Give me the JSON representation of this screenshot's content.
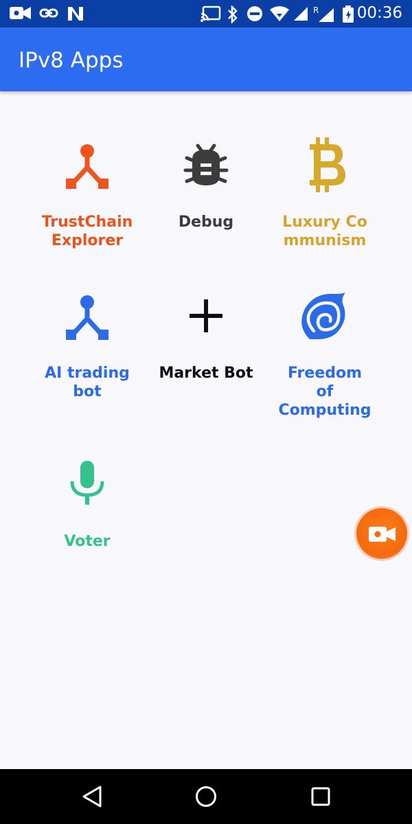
{
  "status_bar": {
    "time": "00:36",
    "icons": [
      "video-camera-icon",
      "link-icon",
      "n-logo-icon",
      "cast-icon",
      "bluetooth-icon",
      "do-not-disturb-icon",
      "wifi-icon",
      "signal-icon",
      "roaming-signal-icon",
      "battery-icon"
    ]
  },
  "app_bar": {
    "title": "IPv8 Apps"
  },
  "apps": [
    {
      "label": "TrustChain\nExplorer",
      "icon": "trustchain-icon",
      "color": "#e8541a"
    },
    {
      "label": "Debug",
      "icon": "bug-icon",
      "color": "#3c3c3c"
    },
    {
      "label": "Luxury Co\nmmunism",
      "icon": "bitcoin-icon",
      "color": "#d4a52a"
    },
    {
      "label": "AI trading\nbot",
      "icon": "network-icon",
      "color": "#2b6be8"
    },
    {
      "label": "Market Bot",
      "icon": "plus-icon",
      "color": "#0f0f0f"
    },
    {
      "label": "Freedom\nof\nComputing",
      "icon": "swirl-icon",
      "color": "#2b6be8"
    },
    {
      "label": "Voter",
      "icon": "microphone-icon",
      "color": "#34c28a"
    }
  ],
  "fab": {
    "icon": "video-camera-icon",
    "color": "#f46a0d"
  },
  "nav_bar": {
    "buttons": [
      "back-icon",
      "home-icon",
      "recents-icon"
    ]
  }
}
